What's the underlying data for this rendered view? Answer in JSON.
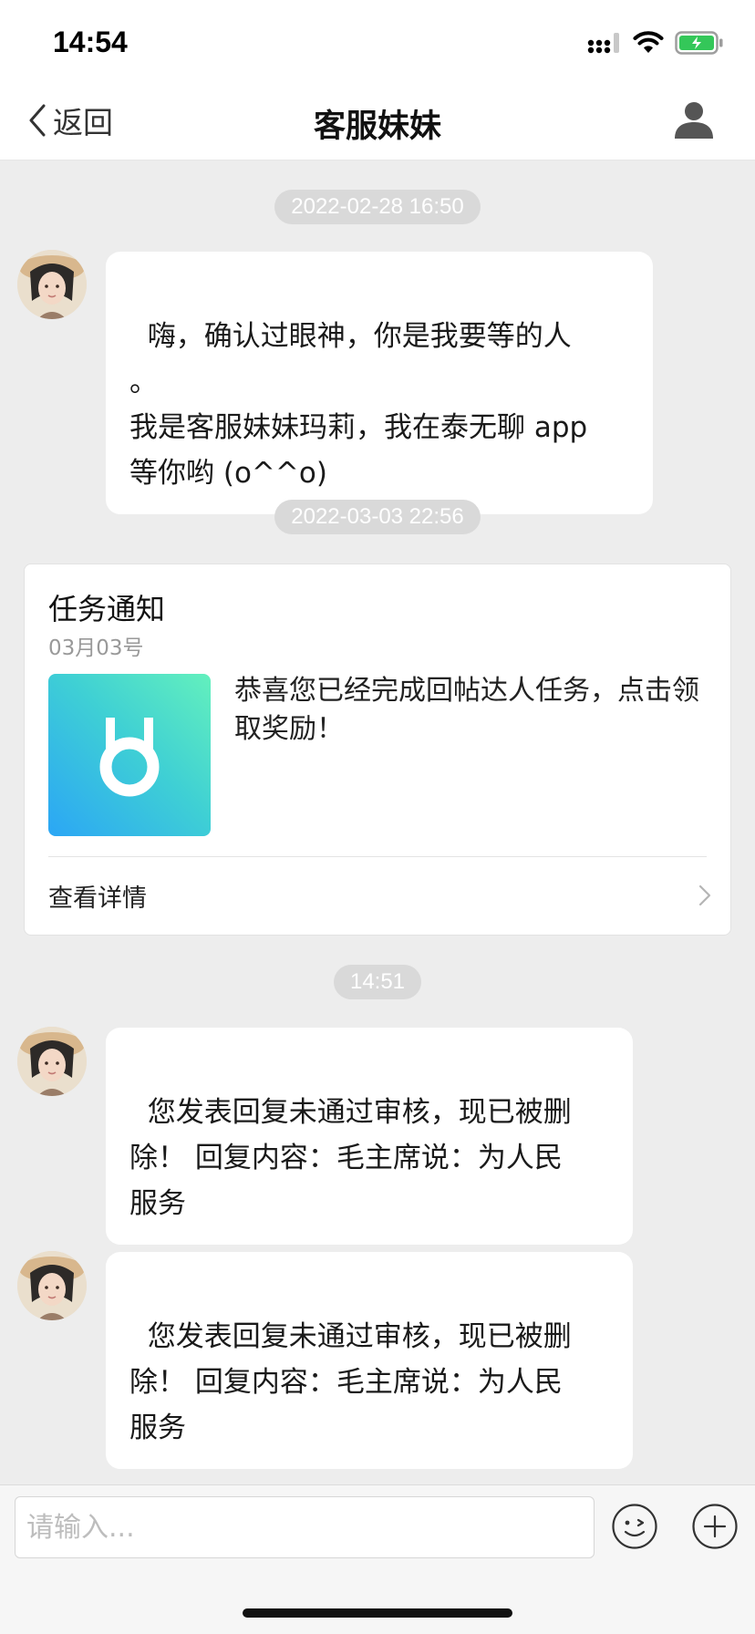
{
  "status_bar": {
    "time": "14:54"
  },
  "nav": {
    "back_label": "返回",
    "title": "客服妹妹"
  },
  "chat": {
    "timestamps": [
      "2022-02-28 16:50",
      "2022-03-03 22:56",
      "14:51"
    ],
    "messages": [
      {
        "text": "嗨，确认过眼神，你是我要等的人\n。\n我是客服妹妹玛莉，我在泰无聊 app\n等你哟 (o^^o)"
      },
      {
        "text": "您发表回复未通过审核，现已被删\n除！ 回复内容：毛主席说：为人民\n服务"
      },
      {
        "text": "您发表回复未通过审核，现已被删\n除！ 回复内容：毛主席说：为人民\n服务"
      }
    ],
    "task_card": {
      "title": "任务通知",
      "date": "03月03号",
      "text": "恭喜您已经完成回帖达人任务，点击领取奖励！",
      "detail_label": "查看详情",
      "thumb_icon": "medal-icon"
    }
  },
  "input": {
    "placeholder": "请输入..."
  },
  "colors": {
    "background": "#ededed",
    "bubble": "#ffffff",
    "battery": "#34c759",
    "thumb_gradient": [
      "#2ba6f5",
      "#63f0bd"
    ]
  }
}
